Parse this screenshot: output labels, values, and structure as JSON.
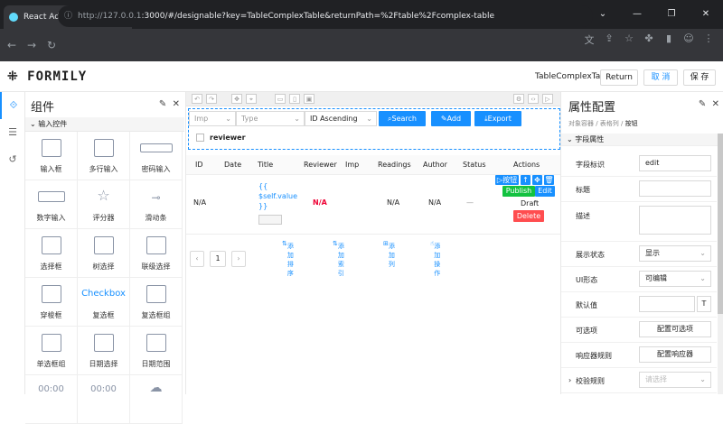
{
  "browser": {
    "tab_title": "React Admin Template",
    "new_tab": "+",
    "url_host": "http://127.0.0.1",
    "url_rest": ":3000/#/designable?key=TableComplexTable&returnPath=%2Ftable%2Fcomplex-table"
  },
  "header": {
    "logo": "FORMILY",
    "name": "TableComplexTable",
    "return_label": "Return",
    "cancel_label": "取 消",
    "save_label": "保 存"
  },
  "components": {
    "title": "组件",
    "group": "输入控件",
    "items": [
      "输入框",
      "多行输入",
      "密码输入",
      "数字输入",
      "评分器",
      "滑动条",
      "选择框",
      "树选择",
      "联级选择",
      "穿梭框",
      "复选框",
      "复选框组",
      "单选框组",
      "日期选择",
      "日期范围"
    ],
    "checkbox_text": "Checkbox",
    "row5_icons": [
      "00:00",
      "00:00",
      ""
    ]
  },
  "canvas": {
    "filters": [
      {
        "placeholder": "Imp"
      },
      {
        "placeholder": "Type"
      },
      {
        "value": "ID Ascending"
      }
    ],
    "search_label": "Search",
    "add_label": "Add",
    "export_label": "Export",
    "reviewer_label": "reviewer",
    "columns": [
      "ID",
      "Date",
      "Title",
      "Reviewer",
      "Imp",
      "Readings",
      "Author",
      "Status",
      "Actions"
    ],
    "row": {
      "id": "N/A",
      "title_line1": "{{",
      "title_line2": "$self.value",
      "title_line3": "}}",
      "reviewer": "N/A",
      "readings": "N/A",
      "author": "N/A",
      "status": "—",
      "tag_button": "按钮",
      "publish": "Publish",
      "edit": "Edit",
      "draft": "Draft",
      "delete": "Delete"
    },
    "add_bar": [
      "添加排序",
      "添加索引",
      "添加列",
      "添加操作"
    ],
    "pagination": {
      "prev": "‹",
      "page": "1",
      "next": "›"
    }
  },
  "props": {
    "title": "属性配置",
    "breadcrumb_prefix": "对象容器 / 表格列 /",
    "breadcrumb_current": "按钮",
    "section": "字段属性",
    "rows": [
      {
        "label": "字段标识",
        "value": "edit"
      },
      {
        "label": "标题",
        "value": ""
      },
      {
        "label": "描述",
        "value": ""
      },
      {
        "label": "展示状态",
        "value": "显示"
      },
      {
        "label": "UI形态",
        "value": "可编辑"
      },
      {
        "label": "默认值",
        "value": ""
      },
      {
        "label": "可选项",
        "value": "配置可选项"
      },
      {
        "label": "响应器规则",
        "value": "配置响应器"
      },
      {
        "label": "校验规则",
        "value": "请选择"
      }
    ]
  }
}
